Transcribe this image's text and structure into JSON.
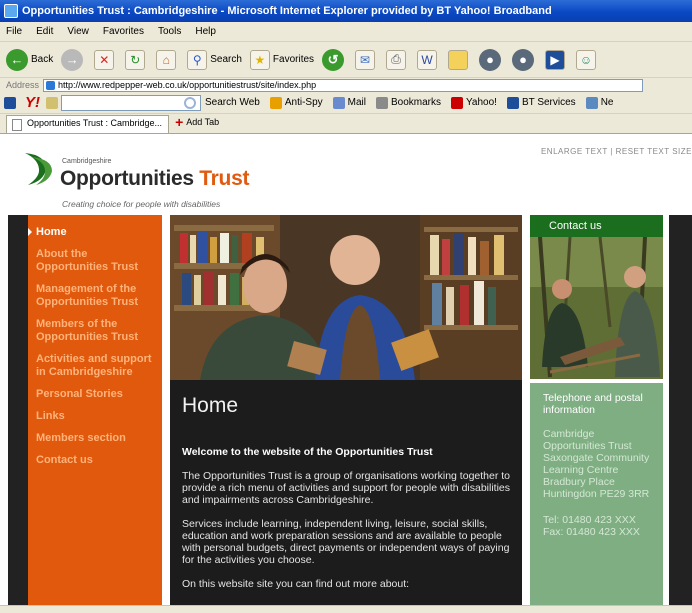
{
  "window": {
    "title": "Opportunities Trust : Cambridgeshire - Microsoft Internet Explorer provided by BT Yahoo! Broadband"
  },
  "menu": [
    "File",
    "Edit",
    "View",
    "Favorites",
    "Tools",
    "Help"
  ],
  "toolbar": {
    "back_label": "Back",
    "search_label": "Search",
    "favorites_label": "Favorites"
  },
  "address": {
    "label": "Address",
    "url": "http://www.redpepper-web.co.uk/opportunitiestrust/site/index.php"
  },
  "yahoo_toolbar": {
    "search_button": "Search Web",
    "items": [
      "Anti-Spy",
      "Mail",
      "Bookmarks",
      "Yahoo!",
      "BT Services",
      "Ne"
    ]
  },
  "tabs": {
    "active_tab": "Opportunities Trust : Cambridge...",
    "add_tab": "Add Tab"
  },
  "page": {
    "text_controls": "ENLARGE TEXT  |  RESET TEXT SIZE",
    "logo": {
      "small": "Cambridgeshire",
      "name_main": "Opportunities ",
      "name_accent": "Trust",
      "tagline": "Creating choice for people with disabilities"
    },
    "nav": [
      "Home",
      "About the Opportunities Trust",
      "Management of the Opportunities Trust",
      "Members of the Opportunities Trust",
      "Activities and support in Cambridgeshire",
      "Personal Stories",
      "Links",
      "Members section",
      "Contact us"
    ],
    "main": {
      "heading": "Home",
      "welcome": "Welcome to the website of the Opportunities Trust",
      "para1": "The Opportunities Trust is a group of organisations working together to provide a rich menu of activities and support for people with disabilities and impairments across Cambridgeshire.",
      "para2": "Services include learning, independent living, leisure, social skills, education and work preparation sessions and are available to people with personal budgets, direct payments or independent ways of paying for the activities you choose.",
      "para3": "On this website site you can find out more about:"
    },
    "sidebar": {
      "contact_heading": "Contact us",
      "info_heading": "Telephone and postal information",
      "address": "Cambridge Opportunities Trust Saxongate Community Learning Centre Bradbury Place Huntingdon PE29 3RR",
      "tel": "Tel: 01480 423 XXX",
      "fax": "Fax: 01480 423 XXX"
    }
  },
  "colors": {
    "nav_bg": "#e0590d",
    "nav_link": "#ffb37a",
    "main_bg": "#1c1c1c",
    "contact_head": "#1a6e1d",
    "contact_info": "#7fae83",
    "logo_accent": "#e05a10"
  }
}
